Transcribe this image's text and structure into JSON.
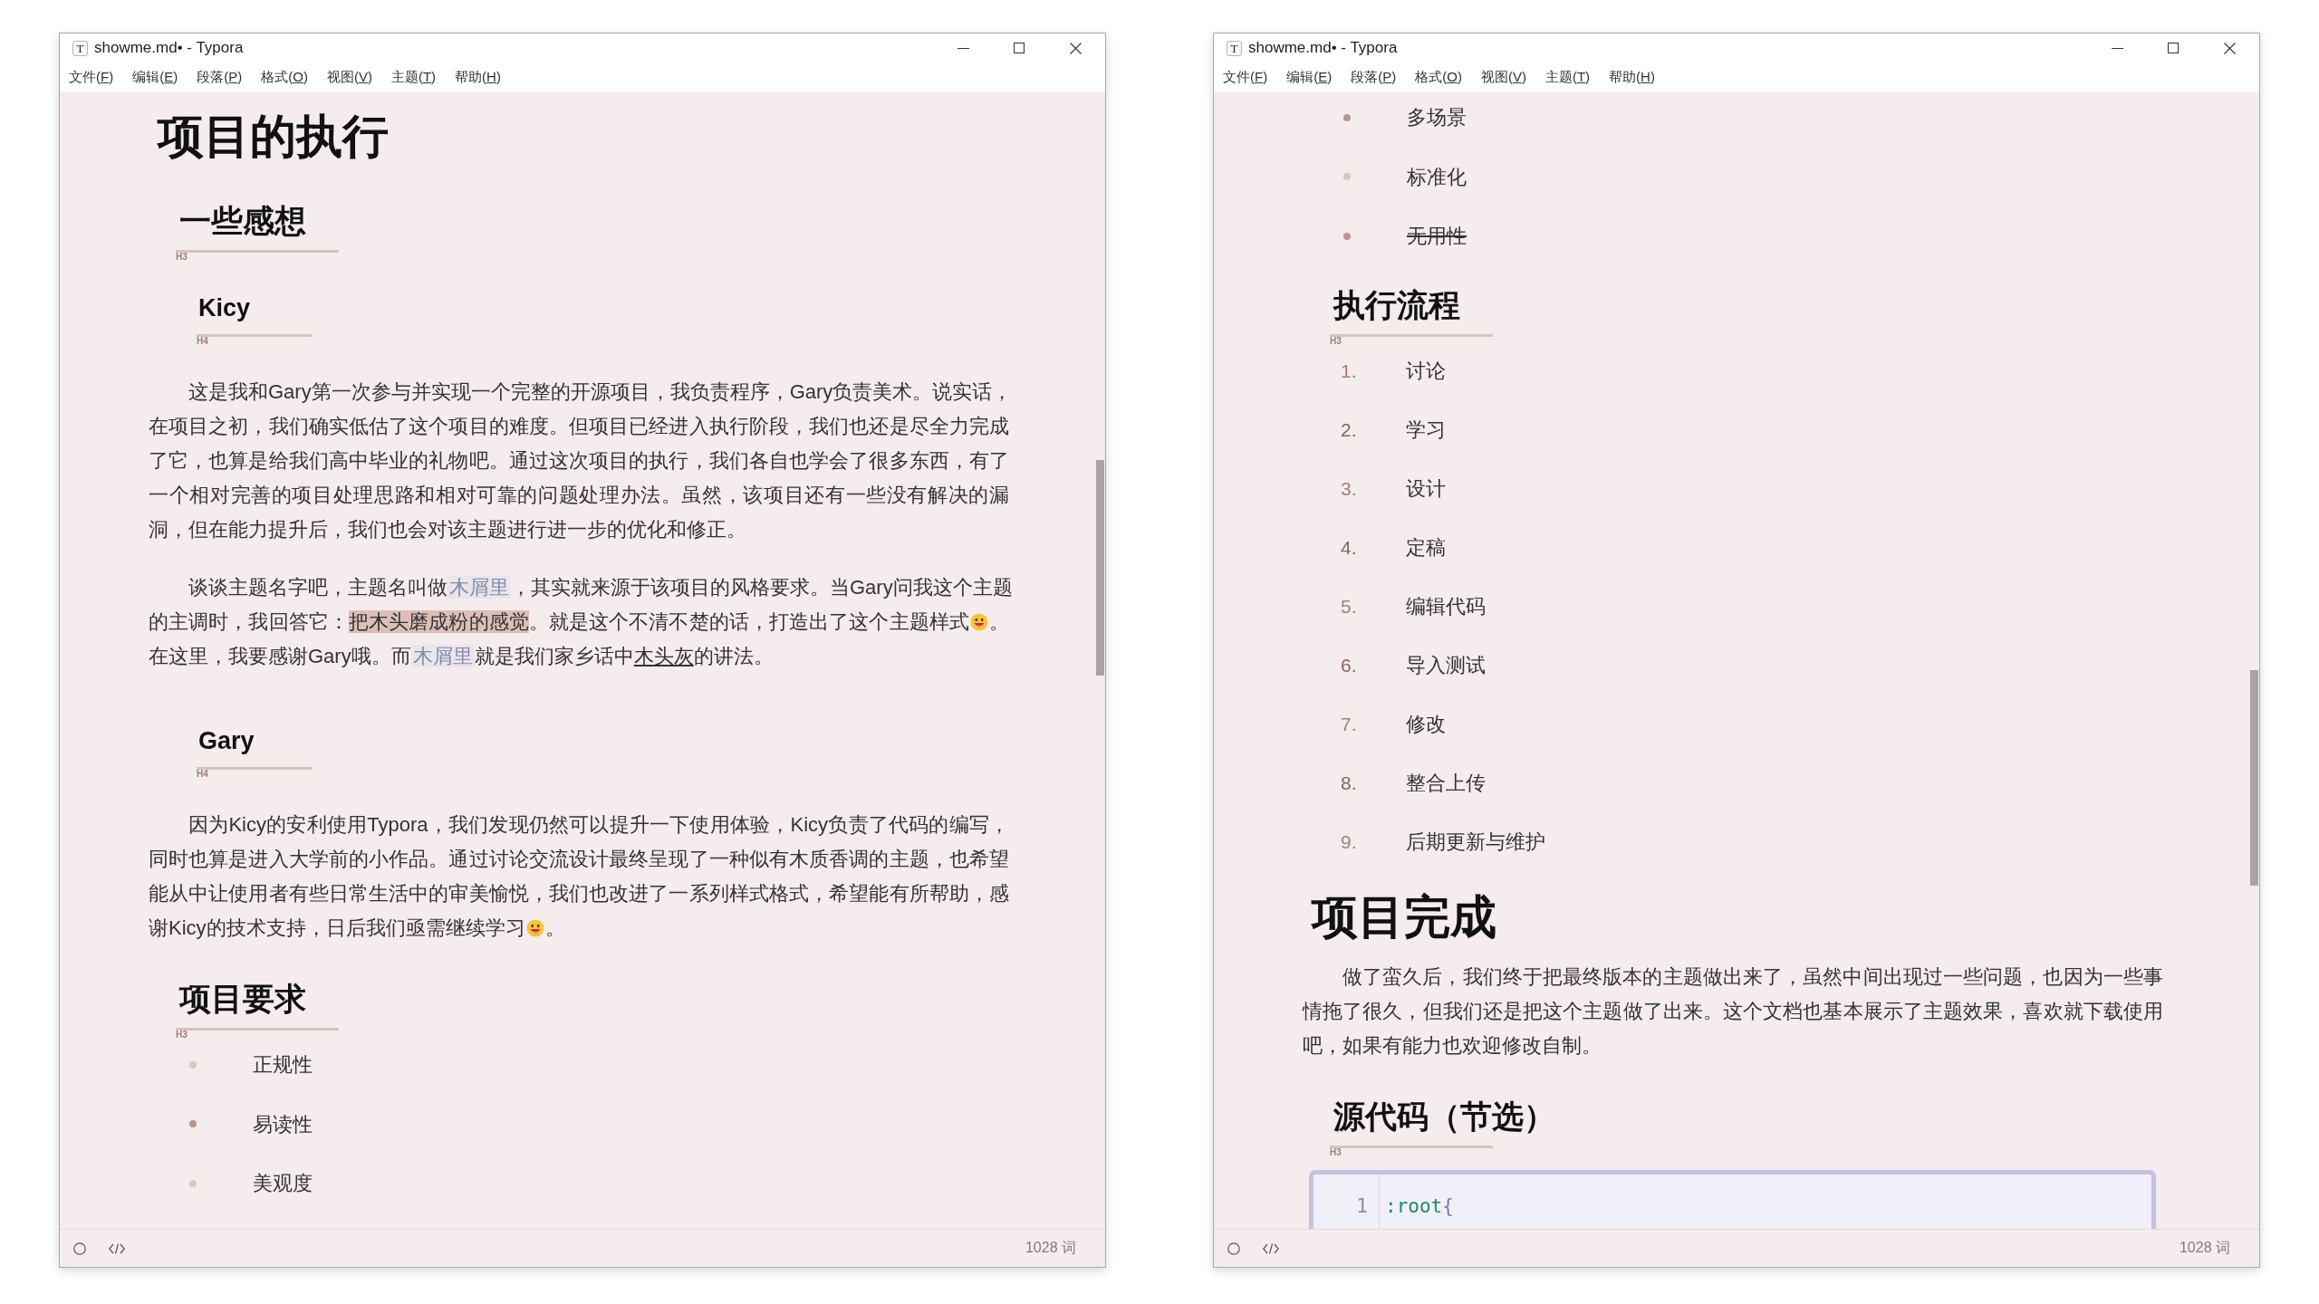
{
  "windows": [
    {
      "app_icon": "T",
      "title": "showme.md• - Typora",
      "menu": [
        {
          "before": "文件(",
          "key": "F",
          "after": ")"
        },
        {
          "before": "编辑(",
          "key": "E",
          "after": ")"
        },
        {
          "before": "段落(",
          "key": "P",
          "after": ")"
        },
        {
          "before": "格式(",
          "key": "O",
          "after": ")"
        },
        {
          "before": "视图(",
          "key": "V",
          "after": ")"
        },
        {
          "before": "主题(",
          "key": "T",
          "after": ")"
        },
        {
          "before": "帮助(",
          "key": "H",
          "after": ")"
        }
      ],
      "document": [
        {
          "kind": "h1",
          "text": "项目的执行"
        },
        {
          "kind": "h3",
          "text": "一些感想",
          "tag": "H3"
        },
        {
          "kind": "h4",
          "text": "Kicy",
          "tag": "H4"
        },
        {
          "kind": "paragraph",
          "lines": [
            {
              "segments": [
                {
                  "kind": "text",
                  "text": "这是我和Gary第一次参与并实现一个完整的开源项目，我负责程序，Gary负责美术。说实话，"
                }
              ]
            },
            {
              "segments": [
                {
                  "kind": "text",
                  "text": "在项目之初，我们确实低估了这个项目的难度。但项目已经进入执行阶段，我们也还是尽全力完成"
                }
              ]
            },
            {
              "segments": [
                {
                  "kind": "text",
                  "text": "了它，也算是给我们高中毕业的礼物吧。通过这次项目的执行，我们各自也学会了很多东西，有了"
                }
              ]
            },
            {
              "segments": [
                {
                  "kind": "text",
                  "text": "一个相对完善的项目处理思路和相对可靠的问题处理办法。虽然，该项目还有一些没有解决的漏"
                }
              ]
            },
            {
              "segments": [
                {
                  "kind": "text",
                  "text": "洞，但在能力提升后，我们也会对该主题进行进一步的优化和修正。"
                }
              ]
            }
          ]
        },
        {
          "kind": "paragraph",
          "lines": [
            {
              "segments": [
                {
                  "kind": "text",
                  "text": "谈谈主题名字吧，主题名叫做"
                },
                {
                  "kind": "code",
                  "text": "木屑里"
                },
                {
                  "kind": "text",
                  "text": "，其实就来源于该项目的风格要求。当Gary问我这个主题"
                }
              ]
            },
            {
              "segments": [
                {
                  "kind": "text",
                  "text": "的主调时，我回答它："
                },
                {
                  "kind": "mark",
                  "text": "把木头磨成粉的感觉"
                },
                {
                  "kind": "text",
                  "text": "。就是这个不清不楚的话，打造出了这个主题样式"
                },
                {
                  "kind": "emoji"
                },
                {
                  "kind": "text",
                  "text": "。"
                }
              ]
            },
            {
              "segments": [
                {
                  "kind": "text",
                  "text": "在这里，我要感谢Gary哦。而"
                },
                {
                  "kind": "code",
                  "text": "木屑里"
                },
                {
                  "kind": "text",
                  "text": "就是我们家乡话中"
                },
                {
                  "kind": "underline",
                  "text": "木头灰"
                },
                {
                  "kind": "text",
                  "text": "的讲法。"
                }
              ]
            }
          ]
        },
        {
          "kind": "h4",
          "text": "Gary",
          "tag": "H4"
        },
        {
          "kind": "paragraph",
          "lines": [
            {
              "segments": [
                {
                  "kind": "text",
                  "text": "因为Kicy的安利使用Typora，我们发现仍然可以提升一下使用体验，Kicy负责了代码的编写，"
                }
              ]
            },
            {
              "segments": [
                {
                  "kind": "text",
                  "text": "同时也算是进入大学前的小作品。通过讨论交流设计最终呈现了一种似有木质香调的主题，也希望"
                }
              ]
            },
            {
              "segments": [
                {
                  "kind": "text",
                  "text": "能从中让使用者有些日常生活中的审美愉悦，我们也改进了一系列样式格式，希望能有所帮助，感"
                }
              ]
            },
            {
              "segments": [
                {
                  "kind": "text",
                  "text": "谢Kicy的技术支持，日后我们亟需继续学习"
                },
                {
                  "kind": "emoji"
                },
                {
                  "kind": "text",
                  "text": "。"
                }
              ]
            }
          ]
        },
        {
          "kind": "h3",
          "text": "项目要求",
          "tag": "H3"
        },
        {
          "kind": "bullet_list",
          "items": [
            {
              "text": "正规性",
              "color": "#dcc6c0",
              "struck": false
            },
            {
              "text": "易读性",
              "color": "#b9968f",
              "struck": false
            },
            {
              "text": "美观度",
              "color": "#dcc6c0",
              "struck": false
            }
          ]
        }
      ],
      "status_bar": {
        "word_count": "1028 词"
      }
    },
    {
      "app_icon": "T",
      "title": "showme.md• - Typora",
      "menu": [
        {
          "before": "文件(",
          "key": "F",
          "after": ")"
        },
        {
          "before": "编辑(",
          "key": "E",
          "after": ")"
        },
        {
          "before": "段落(",
          "key": "P",
          "after": ")"
        },
        {
          "before": "格式(",
          "key": "O",
          "after": ")"
        },
        {
          "before": "视图(",
          "key": "V",
          "after": ")"
        },
        {
          "before": "主题(",
          "key": "T",
          "after": ")"
        },
        {
          "before": "帮助(",
          "key": "H",
          "after": ")"
        }
      ],
      "document": [
        {
          "kind": "bullet_list",
          "items": [
            {
              "text": "多场景",
              "color": "#b9968f",
              "struck": false
            },
            {
              "text": "标准化",
              "color": "#dcc6c0",
              "struck": false
            },
            {
              "text": "无用性",
              "color": "#b9968f",
              "struck": true
            }
          ]
        },
        {
          "kind": "h3",
          "text": "执行流程",
          "tag": "H3"
        },
        {
          "kind": "ordered_list",
          "items": [
            {
              "marker": "1.",
              "text": "讨论",
              "color": "#a0817a"
            },
            {
              "marker": "2.",
              "text": "学习",
              "color": "#85655e"
            },
            {
              "marker": "3.",
              "text": "设计",
              "color": "#a0817a"
            },
            {
              "marker": "4.",
              "text": "定稿",
              "color": "#85655e"
            },
            {
              "marker": "5.",
              "text": "编辑代码",
              "color": "#a0817a"
            },
            {
              "marker": "6.",
              "text": "导入测试",
              "color": "#85655e"
            },
            {
              "marker": "7.",
              "text": "修改",
              "color": "#a0817a"
            },
            {
              "marker": "8.",
              "text": "整合上传",
              "color": "#85655e"
            },
            {
              "marker": "9.",
              "text": "后期更新与维护",
              "color": "#a0817a"
            }
          ]
        },
        {
          "kind": "h1",
          "text": "项目完成"
        },
        {
          "kind": "paragraph",
          "lines": [
            {
              "segments": [
                {
                  "kind": "text",
                  "text": "做了蛮久后，我们终于把最终版本的主题做出来了，虽然中间出现过一些问题，也因为一些事"
                }
              ]
            },
            {
              "segments": [
                {
                  "kind": "text",
                  "text": "情拖了很久，但我们还是把这个主题做了出来。这个文档也基本展示了主题效果，喜欢就下载使用"
                }
              ]
            },
            {
              "segments": [
                {
                  "kind": "text",
                  "text": "吧，如果有能力也欢迎修改自制。"
                }
              ]
            }
          ]
        },
        {
          "kind": "h3",
          "text": "源代码（节选）",
          "tag": "H3"
        },
        {
          "kind": "code",
          "lines": [
            {
              "number": "1",
              "tokens": [
                {
                  "kind": "selector",
                  "text": ":root"
                },
                {
                  "kind": "punct",
                  "text": "{"
                }
              ]
            }
          ]
        }
      ],
      "status_bar": {
        "word_count": "1028 词"
      }
    }
  ]
}
